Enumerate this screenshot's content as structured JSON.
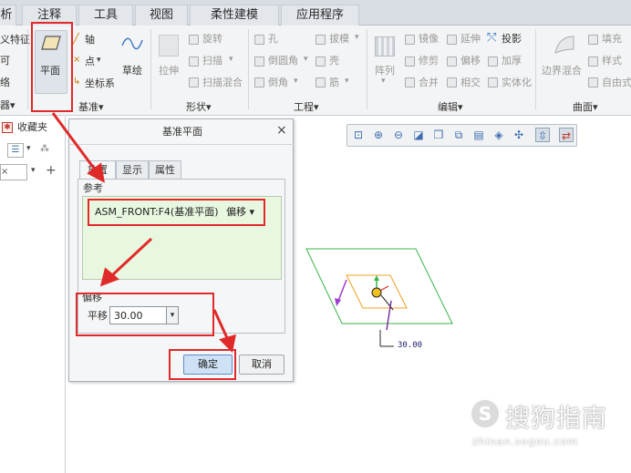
{
  "menu": {
    "tabs": [
      {
        "label": "析"
      },
      {
        "label": "注释"
      },
      {
        "label": "工具"
      },
      {
        "label": "视图"
      },
      {
        "label": "柔性建模"
      },
      {
        "label": "应用程序"
      }
    ]
  },
  "ribbon": {
    "left_stub": [
      "义特征",
      "可",
      "络"
    ],
    "datum": {
      "plane": "平面",
      "axis": "轴",
      "point": "点",
      "csys": "坐标系",
      "sketch": "草绘",
      "group": "基准"
    },
    "shape": {
      "extrude": "拉伸",
      "revolve": "旋转",
      "sweep": "扫描",
      "swept_blend": "扫描混合",
      "group": "形状"
    },
    "engineering": {
      "hole": "孔",
      "round": "倒圆角",
      "chamfer": "倒角",
      "draft": "拔模",
      "shell": "壳",
      "rib": "筋",
      "group": "工程"
    },
    "editing": {
      "pattern": "阵列",
      "mirror": "镜像",
      "trim": "修剪",
      "merge": "合并",
      "extend": "延伸",
      "offset": "偏移",
      "intersect": "相交",
      "project": "投影",
      "thicken": "加厚",
      "solidify": "实体化",
      "group": "编辑"
    },
    "surfaces": {
      "boundary_blend": "边界混合",
      "fill": "填充",
      "style": "样式",
      "freeform": "自由式",
      "group": "曲面"
    }
  },
  "left_panel": {
    "favorites": "收藏夹"
  },
  "dialog": {
    "title": "基准平面",
    "tabs": [
      "放置",
      "显示",
      "属性"
    ],
    "references_label": "参考",
    "reference_name": "ASM_FRONT:F4(基准平面)",
    "reference_constraint": "偏移",
    "offset_label": "偏移",
    "translation_label": "平移",
    "translation_value": "30.00",
    "ok": "确定",
    "cancel": "取消",
    "close": "×"
  },
  "viewport": {
    "dimension_label": "30.00"
  },
  "watermark": {
    "brand": "搜狗指南",
    "url": "zhinan.sogou.com"
  },
  "colors": {
    "annotation_red": "#e02a2a",
    "datum_plane": "#39b54a",
    "new_plane": "#f0a020",
    "reference_area": "#e8f7df"
  }
}
